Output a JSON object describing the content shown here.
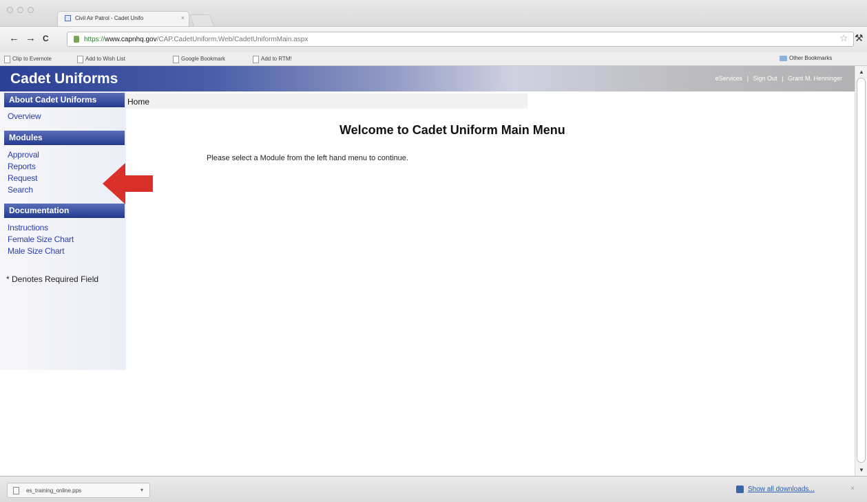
{
  "browser": {
    "tab_title": "Civil Air Patrol - Cadet Unifo",
    "tab_close": "×",
    "url_scheme": "https://",
    "url_host": "www.capnhq.gov",
    "url_path": "/CAP.CadetUniform.Web/CadetUniformMain.aspx",
    "back": "←",
    "forward": "→",
    "reload": "C",
    "star": "☆",
    "wrench": "🔧"
  },
  "bookmarks": {
    "items": [
      "Clip to Evernote",
      "Add to Wish List",
      "Google Bookmark",
      "Add to RTM!"
    ],
    "other": "Other Bookmarks"
  },
  "banner": {
    "title": "Cadet Uniforms",
    "eservices": "eServices",
    "sep1": "|",
    "signout": "Sign Out",
    "sep2": "|",
    "user": "Grant M. Henninger"
  },
  "sidebar": {
    "about_header": "About Cadet Uniforms",
    "overview": "Overview",
    "modules_header": "Modules",
    "modules": [
      "Approval",
      "Reports",
      "Request",
      "Search"
    ],
    "documentation_header": "Documentation",
    "docs": [
      "Instructions",
      "Female Size Chart",
      "Male Size Chart"
    ],
    "required_note": "* Denotes Required Field"
  },
  "main": {
    "breadcrumb": "Home",
    "welcome": "Welcome to Cadet Uniform Main Menu",
    "instruction": "Please select a Module from the left hand menu to continue."
  },
  "annotation": {
    "arrow_color": "#d9302a"
  },
  "downloads": {
    "file": "es_training_online.pps",
    "menu": "▾",
    "show_all": "Show all downloads...",
    "close": "×"
  }
}
